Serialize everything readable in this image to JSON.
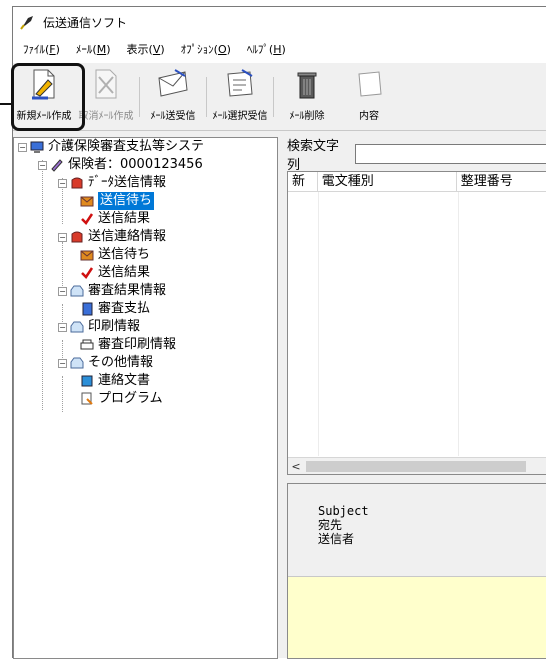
{
  "window": {
    "title": "伝送通信ソフト"
  },
  "menu": [
    {
      "label": "ﾌｧｲﾙ(",
      "key": "F",
      "end": ")"
    },
    {
      "label": "ﾒｰﾙ(",
      "key": "M",
      "end": ")"
    },
    {
      "label": "表示(",
      "key": "V",
      "end": ")"
    },
    {
      "label": "ｵﾌﾟｼｮﾝ(",
      "key": "O",
      "end": ")"
    },
    {
      "label": "ﾍﾙﾌﾟ(",
      "key": "H",
      "end": ")"
    }
  ],
  "toolbar": {
    "new_mail": "新規ﾒｰﾙ作成",
    "cancel_mail": "取消ﾒｰﾙ作成",
    "send_receive": "ﾒｰﾙ送受信",
    "select_receive": "ﾒｰﾙ選択受信",
    "delete_mail": "ﾒｰﾙ削除",
    "content": "内容"
  },
  "tree": {
    "root": "介護保険審査支払等システ",
    "insurer": "保険者：0000123456",
    "data_send": "ﾃﾞｰﾀ送信情報",
    "data_send_wait": "送信待ち",
    "data_send_result": "送信結果",
    "contact_send": "送信連絡情報",
    "contact_wait": "送信待ち",
    "contact_result": "送信結果",
    "review_result": "審査結果情報",
    "review_payment": "審査支払",
    "print_info": "印刷情報",
    "review_print": "審査印刷情報",
    "other_info": "その他情報",
    "contact_doc": "連絡文書",
    "program": "プログラム"
  },
  "search": {
    "label": "検索文字列",
    "value": ""
  },
  "list": {
    "columns": [
      "新",
      "電文種別",
      "整理番号"
    ]
  },
  "message": {
    "subject_label": "Subject",
    "to_label": "宛先",
    "sender_label": "送信者"
  },
  "colors": {
    "selection": "#0078d7",
    "preview_bg": "#ffffcc"
  }
}
